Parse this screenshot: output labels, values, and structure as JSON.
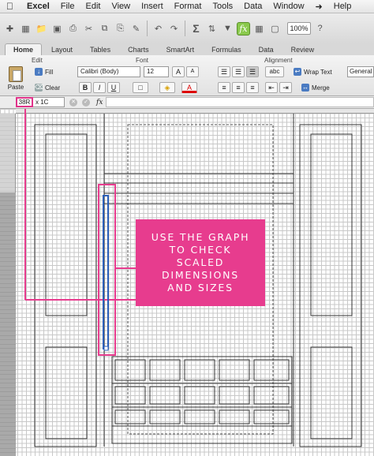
{
  "menubar": {
    "app": "Excel",
    "items": [
      "File",
      "Edit",
      "View",
      "Insert",
      "Format",
      "Tools",
      "Data",
      "Window",
      "Help"
    ]
  },
  "toolbar": {
    "zoom": "100%"
  },
  "tabs": [
    "Home",
    "Layout",
    "Tables",
    "Charts",
    "SmartArt",
    "Formulas",
    "Data",
    "Review"
  ],
  "ribbon": {
    "edit_label": "Edit",
    "font_label": "Font",
    "alignment_label": "Alignment",
    "paste_label": "Paste",
    "fill_label": "Fill",
    "clear_label": "Clear",
    "font_name": "Calibri (Body)",
    "font_size": "12",
    "wrap_text_label": "Wrap Text",
    "merge_label": "Merge",
    "number_format": "General",
    "abc_label": "abc"
  },
  "formula_bar": {
    "name_box": "38R",
    "name_box_rest": "x 1C",
    "fx": "fx"
  },
  "callout": {
    "lines": [
      "USE THE GRAPH",
      "TO CHECK",
      "SCALED",
      "DIMENSIONS",
      "AND SIZES"
    ]
  },
  "colors": {
    "accent_pink": "#e73c8e",
    "selection_blue": "#2a5fb8"
  }
}
